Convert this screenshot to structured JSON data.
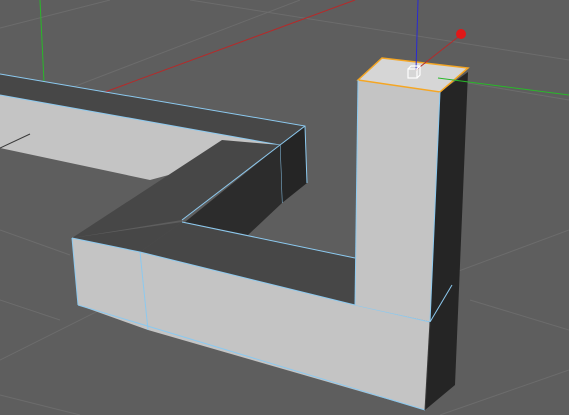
{
  "viewport": {
    "view": "perspective",
    "background": "#5e5e5e",
    "grid_color": "#6c6c6c",
    "axis_colors": {
      "x": "#b52a2a",
      "y": "#29b829",
      "z": "#2a2ad2"
    }
  },
  "scene": {
    "object": "extruded-l-shaped-walls",
    "face_colors": {
      "light": "#c4c4c4",
      "mid": "#474747",
      "dark": "#252525"
    },
    "edge_color": "#8cc9ef",
    "selected_face_color": "#d6d6d6",
    "selection_outline_color": "#f5a623"
  },
  "gizmo": {
    "icon": "cube-icon",
    "handle_color": "#e01818"
  }
}
